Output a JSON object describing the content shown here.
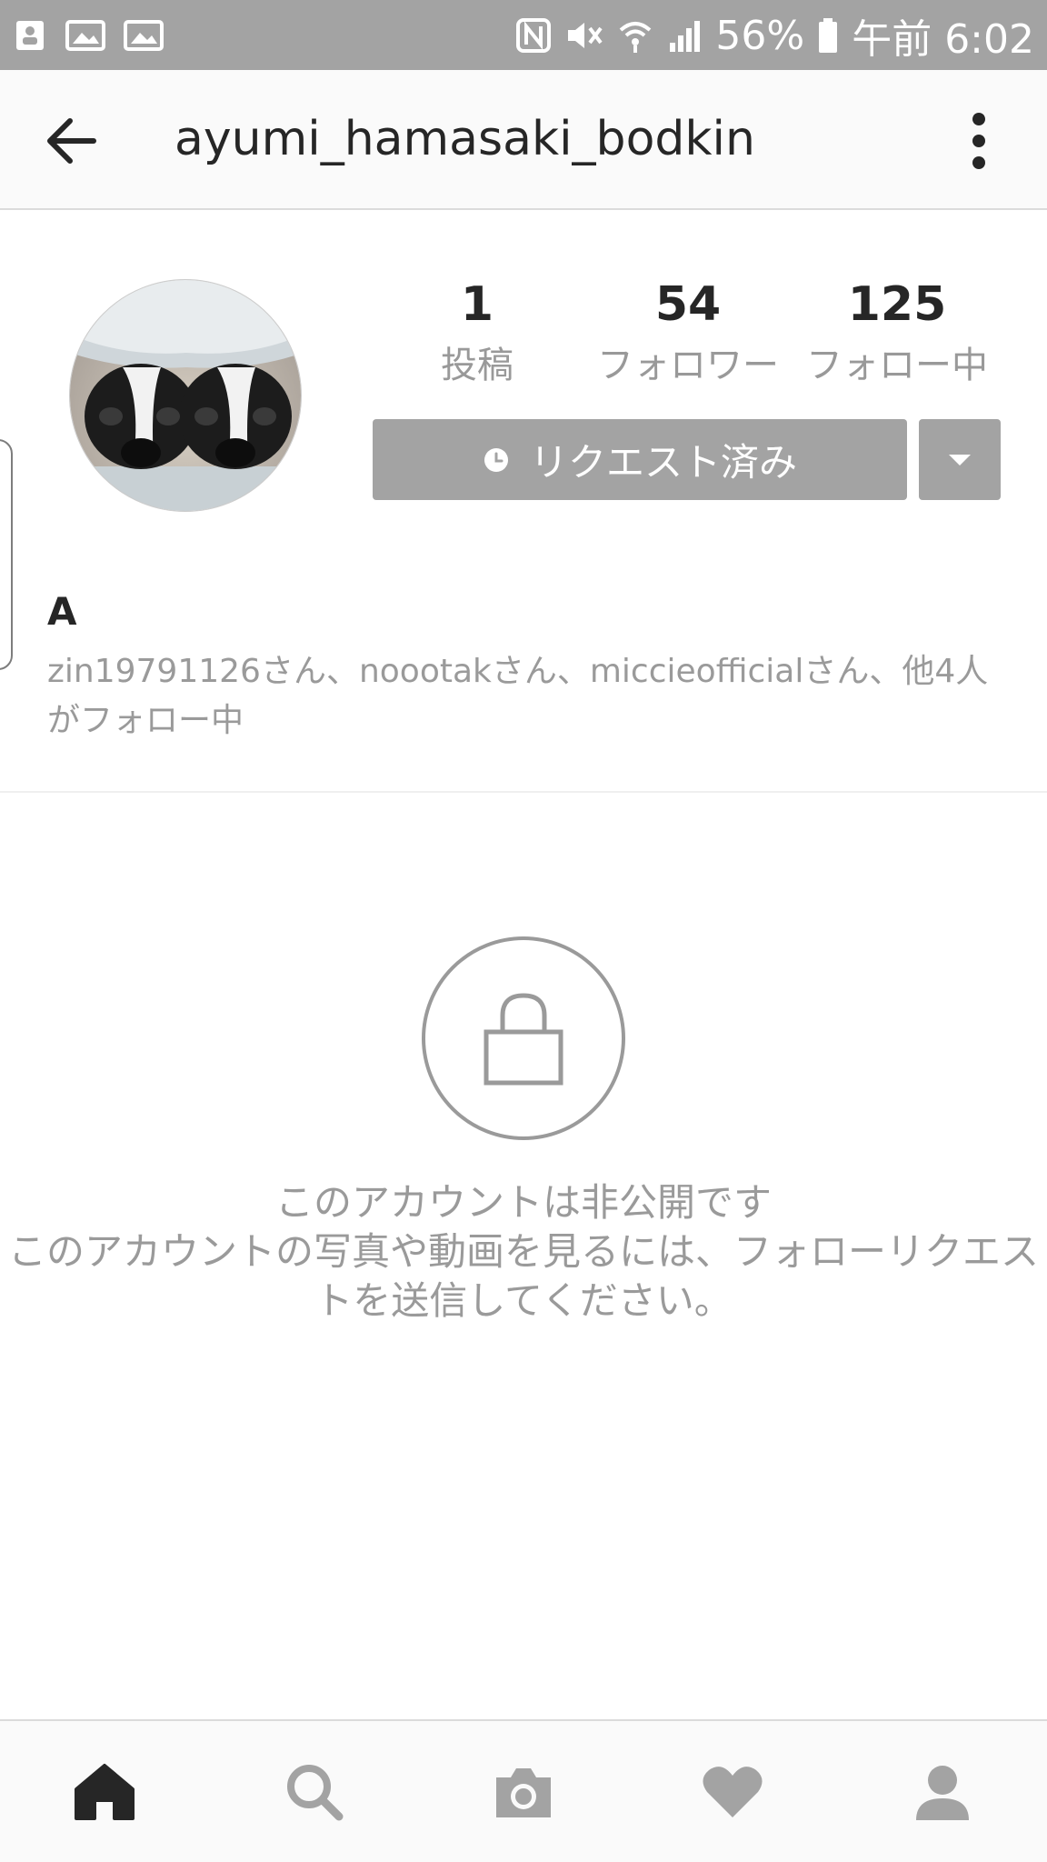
{
  "status_bar": {
    "battery": "56%",
    "time": "午前 6:02",
    "icons": [
      "contact-card-icon",
      "image-icon",
      "image-icon",
      "nfc-icon",
      "mute-icon",
      "wifi-icon",
      "signal-icon",
      "battery-icon"
    ]
  },
  "header": {
    "username": "ayumi_hamasaki_bodkin",
    "back_icon": "arrow-left-icon",
    "menu_icon": "more-vertical-icon"
  },
  "profile": {
    "avatar": "avatar-photo",
    "stats": {
      "posts": {
        "value": "1",
        "label": "投稿"
      },
      "followers": {
        "value": "54",
        "label": "フォロワー"
      },
      "following": {
        "value": "125",
        "label": "フォロー中"
      }
    },
    "request_button_label": "リクエスト済み",
    "display_name": "A",
    "followed_by": "zin19791126さん、noootakさん、miccieofficialさん、他4人がフォロー中"
  },
  "private_notice": {
    "title": "このアカウントは非公開です",
    "description": "このアカウントの写真や動画を見るには、フォローリクエス\nトを送信してください。"
  },
  "bottom_nav": {
    "items": [
      "home-icon",
      "search-icon",
      "camera-icon",
      "heart-icon",
      "profile-icon"
    ],
    "active": "home-icon"
  },
  "colors": {
    "status_bar": "#a3a3a3",
    "button": "#a3a3a3",
    "muted_text": "#9a9a9a",
    "text": "#262626"
  }
}
